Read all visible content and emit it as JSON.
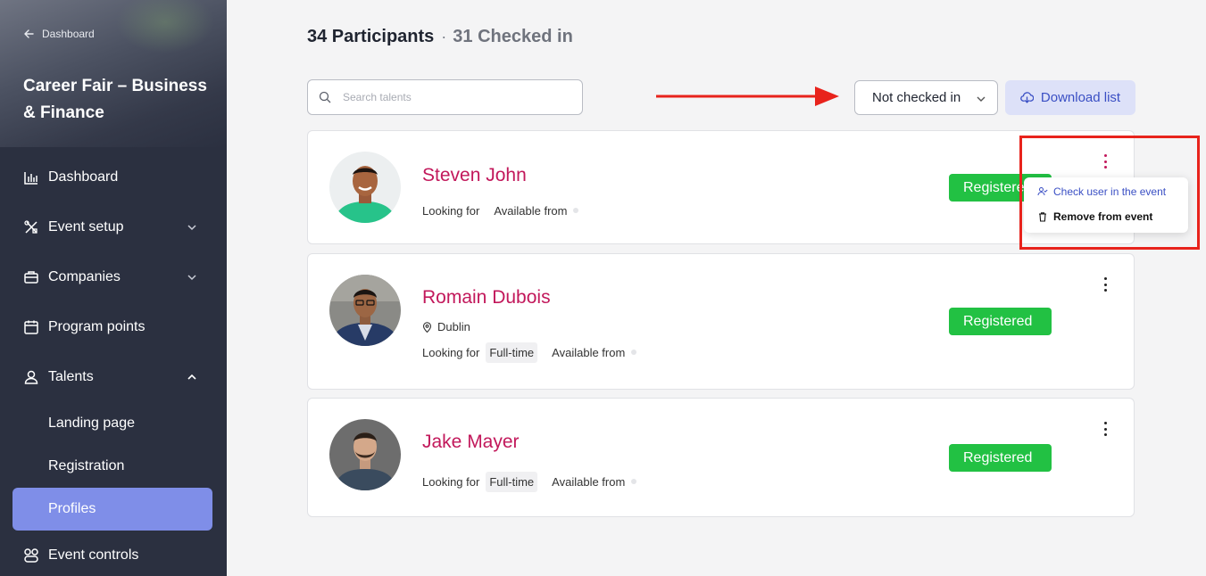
{
  "sidebar": {
    "back_label": "Dashboard",
    "event_title": "Career Fair – Business & Finance",
    "nav": [
      {
        "label": "Dashboard",
        "icon": "bar-chart-icon"
      },
      {
        "label": "Event setup",
        "icon": "tools-icon"
      },
      {
        "label": "Companies",
        "icon": "briefcase-icon"
      },
      {
        "label": "Program points",
        "icon": "calendar-icon"
      },
      {
        "label": "Talents",
        "icon": "user-icon"
      },
      {
        "label": "Event controls",
        "icon": "controls-icon"
      }
    ],
    "talents_sub": [
      {
        "label": "Landing page"
      },
      {
        "label": "Registration"
      },
      {
        "label": "Profiles",
        "active": true
      }
    ]
  },
  "header": {
    "participants": "34 Participants",
    "separator": "·",
    "checked_in": "31 Checked in"
  },
  "search": {
    "placeholder": "Search talents",
    "value": ""
  },
  "filter": {
    "selected": "Not checked in"
  },
  "download": {
    "label": "Download list"
  },
  "participants": [
    {
      "name": "Steven John",
      "location": "",
      "looking_for_label": "Looking for",
      "looking_for": "",
      "available_label": "Available from",
      "status": "Registered"
    },
    {
      "name": "Romain Dubois",
      "location": "Dublin",
      "looking_for_label": "Looking for",
      "looking_for": "Full-time",
      "available_label": "Available from",
      "status": "Registered"
    },
    {
      "name": "Jake Mayer",
      "location": "",
      "looking_for_label": "Looking for",
      "looking_for": "Full-time",
      "available_label": "Available from",
      "status": "Registered"
    }
  ],
  "context_menu": {
    "check_in": "Check user in the event",
    "remove": "Remove from event"
  },
  "colors": {
    "sidebar_bg": "#2b3040",
    "active_nav": "#7f8ee8",
    "name_color": "#c2185b",
    "registered_badge": "#22c143",
    "download_bg": "#dde1f8",
    "annotation_red": "#e8231c"
  }
}
